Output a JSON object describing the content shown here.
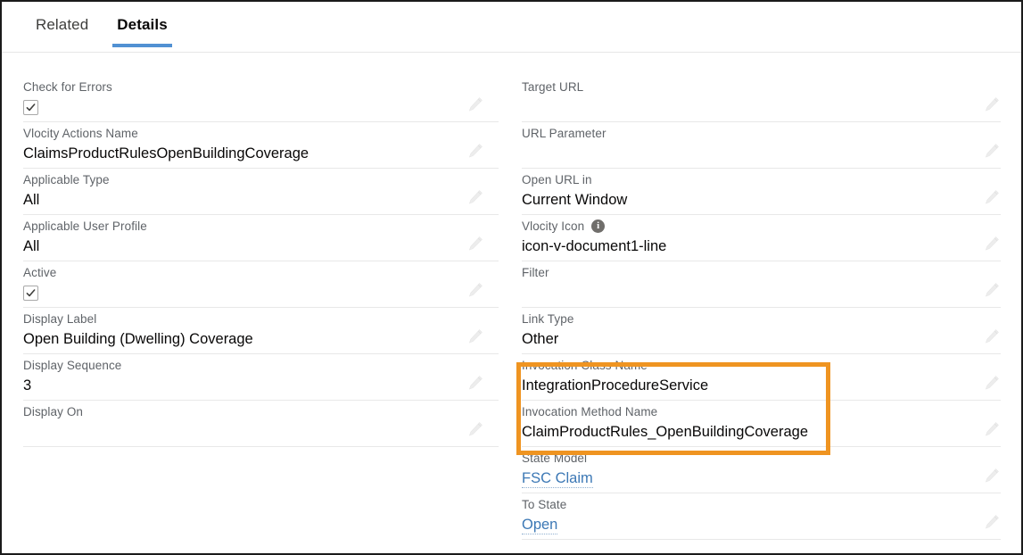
{
  "tabs": [
    {
      "label": "Related",
      "active": false
    },
    {
      "label": "Details",
      "active": true
    }
  ],
  "colors": {
    "tab_underline": "#5191d3",
    "highlight_border": "#ef9421",
    "link": "#3c78b5",
    "label": "#5f6368",
    "value": "#080707",
    "divider": "#e8e8e8"
  },
  "left_column": [
    {
      "label": "Check for Errors",
      "value": "",
      "type": "checkbox",
      "checked": true
    },
    {
      "label": "Vlocity Actions Name",
      "value": "ClaimsProductRulesOpenBuildingCoverage",
      "type": "text"
    },
    {
      "label": "Applicable Type",
      "value": "All",
      "type": "text"
    },
    {
      "label": "Applicable User Profile",
      "value": "All",
      "type": "text"
    },
    {
      "label": "Active",
      "value": "",
      "type": "checkbox",
      "checked": true
    },
    {
      "label": "Display Label",
      "value": "Open Building (Dwelling) Coverage",
      "type": "text"
    },
    {
      "label": "Display Sequence",
      "value": "3",
      "type": "text"
    },
    {
      "label": "Display On",
      "value": "",
      "type": "text"
    }
  ],
  "right_column": [
    {
      "label": "Target URL",
      "value": "",
      "type": "text"
    },
    {
      "label": "URL Parameter",
      "value": "",
      "type": "text"
    },
    {
      "label": "Open URL in",
      "value": "Current Window",
      "type": "text"
    },
    {
      "label": "Vlocity Icon",
      "value": "icon-v-document1-line",
      "type": "text",
      "info": true
    },
    {
      "label": "Filter",
      "value": "",
      "type": "text"
    },
    {
      "label": "Link Type",
      "value": "Other",
      "type": "text"
    },
    {
      "label": "Invocation Class Name",
      "value": "IntegrationProcedureService",
      "type": "text",
      "highlighted": true
    },
    {
      "label": "Invocation Method Name",
      "value": "ClaimProductRules_OpenBuildingCoverage",
      "type": "text",
      "highlighted": true
    },
    {
      "label": "State Model",
      "value": "FSC Claim",
      "type": "link"
    },
    {
      "label": "To State",
      "value": "Open",
      "type": "link"
    }
  ],
  "icons": {
    "edit": "pencil-icon",
    "info": "info-icon",
    "check": "check-icon"
  }
}
